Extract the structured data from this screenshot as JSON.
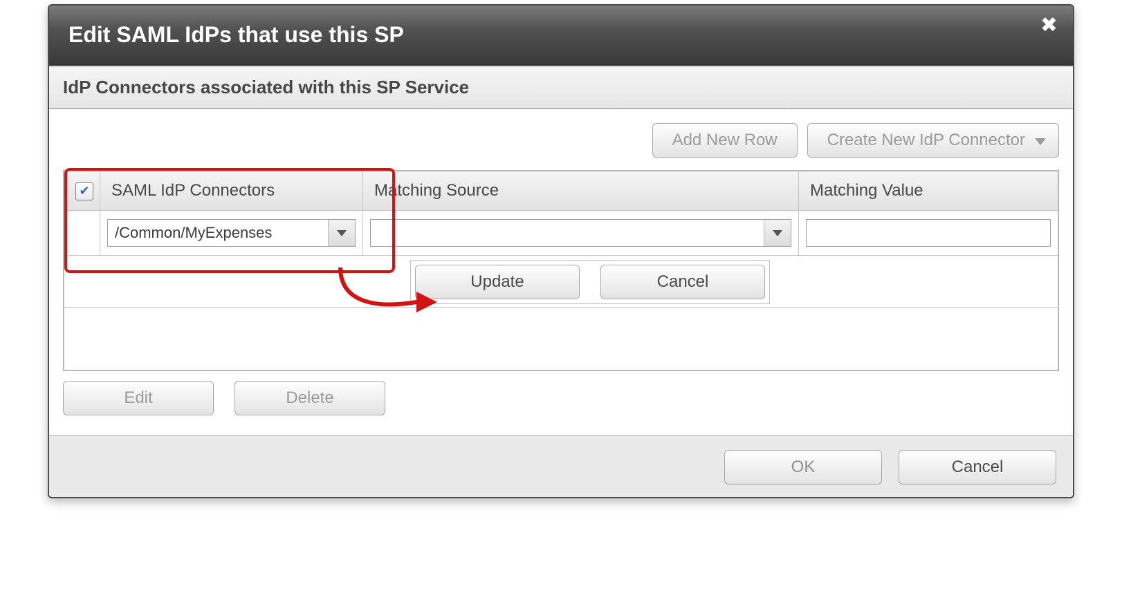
{
  "dialog": {
    "title": "Edit SAML IdPs that use this SP"
  },
  "section": {
    "title": "IdP Connectors associated with this SP Service"
  },
  "actions": {
    "add_row": "Add New Row",
    "create_connector": "Create New IdP Connector"
  },
  "table": {
    "headers": {
      "connectors": "SAML IdP Connectors",
      "matching_source": "Matching Source",
      "matching_value": "Matching Value"
    },
    "row": {
      "checked": true,
      "connector_value": "/Common/MyExpenses",
      "matching_source_value": "",
      "matching_value": ""
    },
    "row_buttons": {
      "update": "Update",
      "cancel": "Cancel"
    }
  },
  "under": {
    "edit": "Edit",
    "delete": "Delete"
  },
  "footer": {
    "ok": "OK",
    "cancel": "Cancel"
  }
}
